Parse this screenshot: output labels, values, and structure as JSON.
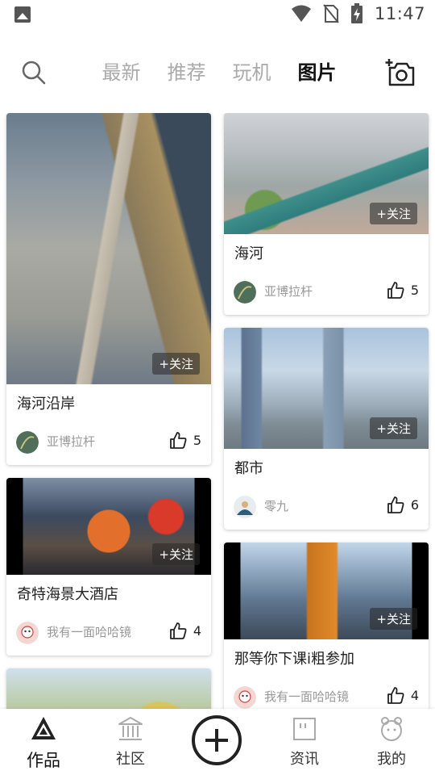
{
  "status": {
    "time": "11:47"
  },
  "tabs": [
    {
      "label": "最新"
    },
    {
      "label": "推荐"
    },
    {
      "label": "玩机"
    },
    {
      "label": "图片"
    }
  ],
  "cards": [
    {
      "title": "海河沿岸",
      "author": "亚博拉杆",
      "likes": "5",
      "follow": "+关注"
    },
    {
      "title": "奇特海景大酒店",
      "author": "我有一面哈哈镜",
      "likes": "4",
      "follow": "+关注"
    },
    {
      "title": "海河",
      "author": "亚博拉杆",
      "likes": "5",
      "follow": "+关注"
    },
    {
      "title": "都市",
      "author": "零九",
      "likes": "6",
      "follow": "+关注"
    },
    {
      "title": "那等你下课i粗参加",
      "author": "我有一面哈哈镜",
      "likes": "4",
      "follow": "+关注"
    }
  ],
  "bottomnav": [
    {
      "label": "作品"
    },
    {
      "label": "社区"
    },
    {
      "label": "资讯"
    },
    {
      "label": "我的"
    }
  ],
  "colors": {
    "accent": "#111111",
    "muted": "#aaaaaa"
  }
}
